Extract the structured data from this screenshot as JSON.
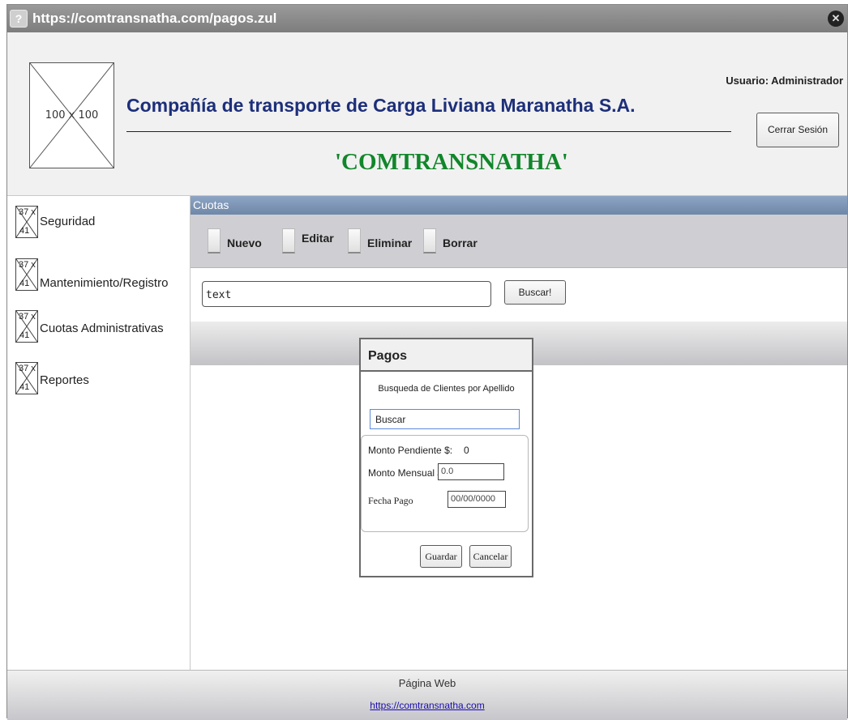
{
  "window": {
    "url": "https://comtransnatha.com/pagos.zul"
  },
  "header": {
    "logo_label": "100 x 100",
    "company": "Compañía de transporte de Carga Liviana Maranatha S.A.",
    "brand": "'COMTRANSNATHA'",
    "user": "Usuario: Administrador",
    "logout": "Cerrar Sesión"
  },
  "sidebar": {
    "icon_top": "37 x",
    "icon_bottom": "41",
    "items": [
      {
        "label": "Seguridad"
      },
      {
        "label": "Mantenimiento/Registro"
      },
      {
        "label": "Cuotas Administrativas"
      },
      {
        "label": "Reportes"
      }
    ]
  },
  "main": {
    "section_title": "Cuotas",
    "toolbar": [
      "Nuevo",
      "Editar",
      "Eliminar",
      "Borrar"
    ],
    "search_value": "text",
    "search_button": "Buscar!"
  },
  "dialog": {
    "title": "Pagos",
    "subtitle": "Busqueda de Clientes por Apellido",
    "search_value": "Buscar",
    "pending_label": "Monto Pendiente $:",
    "pending_value": "0",
    "monthly_label": "Monto Mensual $:",
    "monthly_value": "0.0",
    "date_label": "Fecha Pago",
    "date_value": "00/00/0000",
    "save": "Guardar",
    "cancel": "Cancelar"
  },
  "footer": {
    "title": "Página Web",
    "link": "https://comtransnatha.com"
  }
}
